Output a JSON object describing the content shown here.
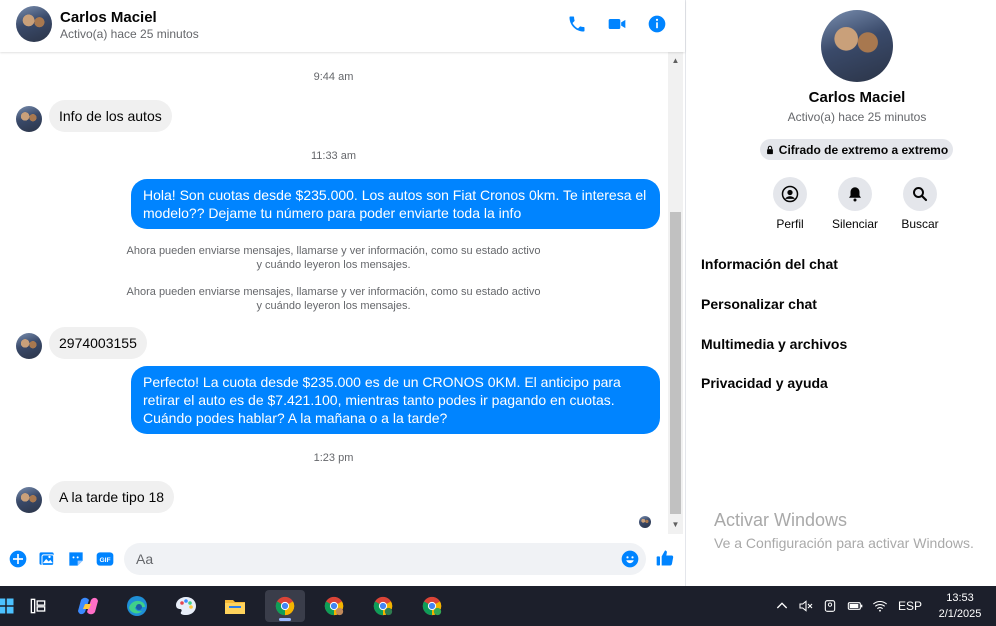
{
  "contact": {
    "name": "Carlos Maciel",
    "status": "Activo(a) hace 25 minutos"
  },
  "messages": [
    {
      "type": "timestamp",
      "text": "9:44 am"
    },
    {
      "type": "incoming",
      "text": "Info de los autos"
    },
    {
      "type": "timestamp",
      "text": "11:33 am"
    },
    {
      "type": "outgoing",
      "text": "Hola! Son cuotas desde $235.000. Los autos son Fiat Cronos 0km. Te interesa el modelo?? Dejame tu número para poder enviarte toda la info"
    },
    {
      "type": "system",
      "line1": "Ahora pueden enviarse mensajes, llamarse y ver información, como su estado activo",
      "line2": "y cuándo leyeron los mensajes."
    },
    {
      "type": "system",
      "line1": "Ahora pueden enviarse mensajes, llamarse y ver información, como su estado activo",
      "line2": "y cuándo leyeron los mensajes."
    },
    {
      "type": "incoming",
      "text": "2974003155"
    },
    {
      "type": "outgoing",
      "text": "Perfecto! La cuota desde $235.000 es de un CRONOS 0KM. El anticipo para retirar el auto es de $7.421.100, mientras tanto podes ir pagando en cuotas. Cuándo podes hablar? A la mañana o a la tarde?"
    },
    {
      "type": "timestamp",
      "text": "1:23 pm"
    },
    {
      "type": "incoming",
      "text": "A la tarde tipo 18"
    }
  ],
  "composer": {
    "placeholder": "Aa",
    "gif_label": "GIF"
  },
  "panel": {
    "encryption_label": "Cifrado de extremo a extremo",
    "actions": [
      {
        "label": "Perfil",
        "icon": "profile-icon"
      },
      {
        "label": "Silenciar",
        "icon": "bell-icon"
      },
      {
        "label": "Buscar",
        "icon": "search-icon"
      }
    ],
    "sections": [
      "Información del chat",
      "Personalizar chat",
      "Multimedia y archivos",
      "Privacidad y ayuda"
    ]
  },
  "watermark": {
    "title": "Activar Windows",
    "subtitle": "Ve a Configuración para activar Windows."
  },
  "taskbar": {
    "language": "ESP",
    "time": "13:53",
    "date": "2/1/2025"
  },
  "colors": {
    "accent": "#0084ff",
    "incoming_bubble": "#f0f0f0",
    "taskbar": "#1c1f2b"
  }
}
